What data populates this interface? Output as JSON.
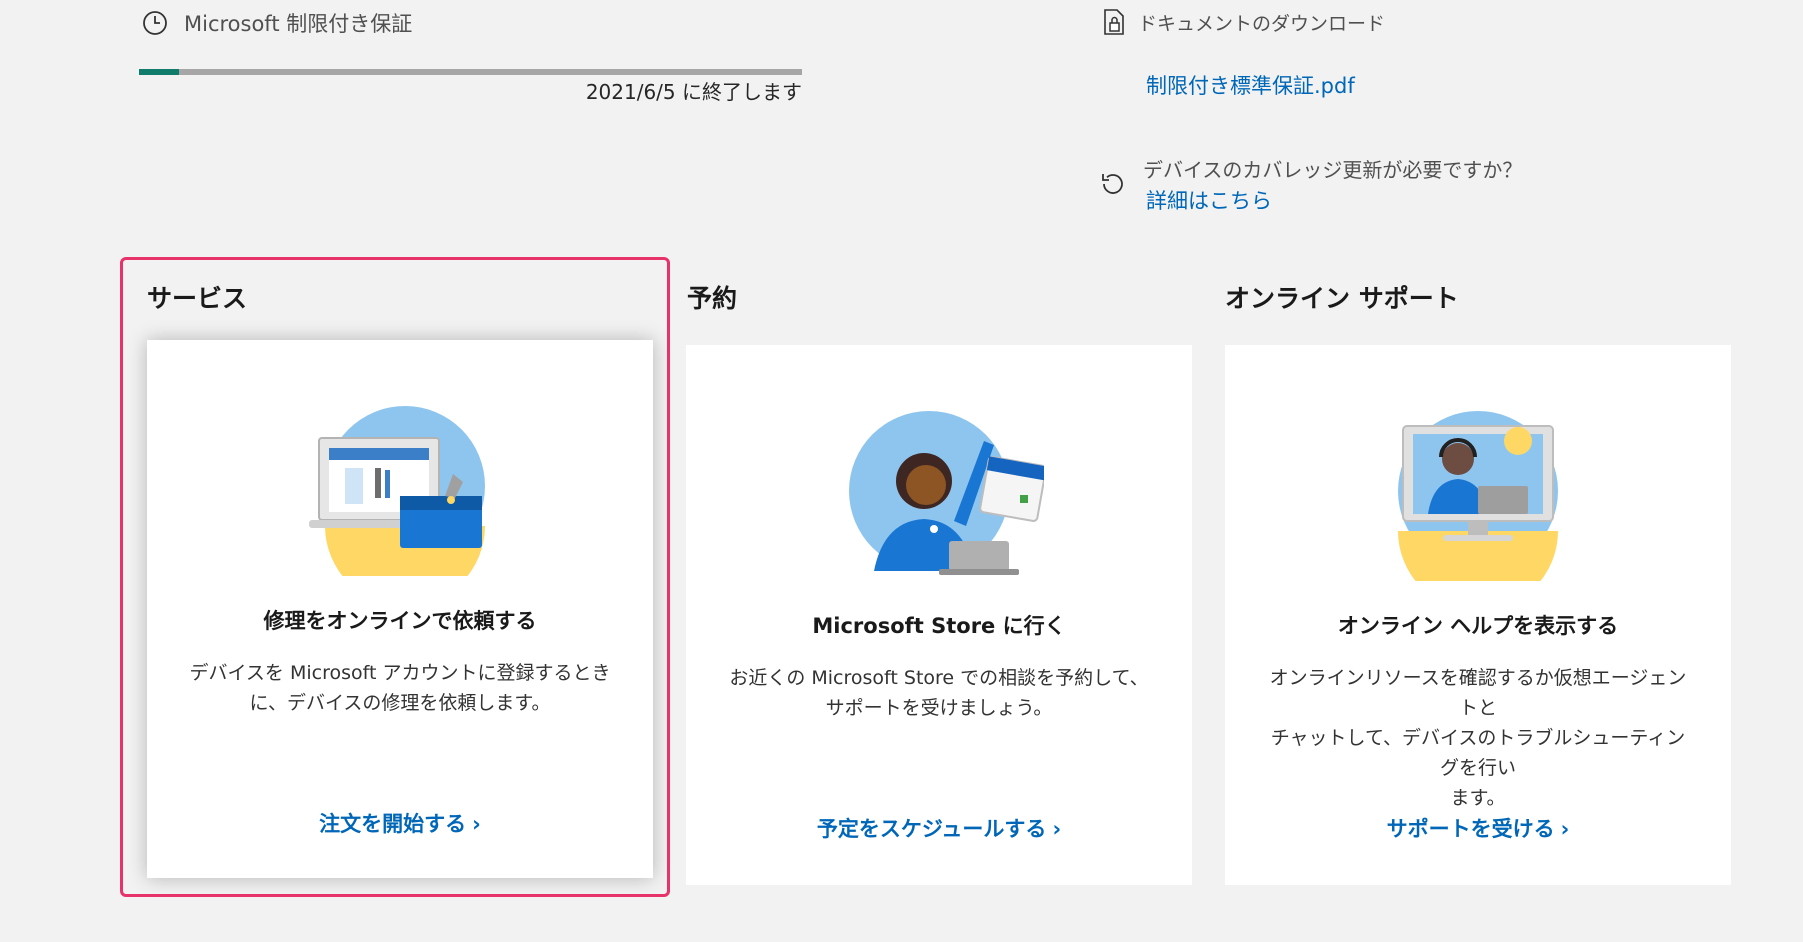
{
  "warranty": {
    "title": "Microsoft 制限付き保証",
    "progress_percent": 6,
    "expiry_text": "2021/6/5 に終了します",
    "colors": {
      "fill": "#107c6b",
      "track": "#a6a6a6"
    },
    "icon": "clock-icon"
  },
  "documents": {
    "heading": "ドキュメントのダウンロード",
    "icon": "document-lock-icon",
    "link_label": "制限付き標準保証.pdf"
  },
  "coverage": {
    "icon": "refresh-icon",
    "question": "デバイスのカバレッジ更新が必要ですか？",
    "link_label": "詳細はこちら"
  },
  "sections": {
    "service": {
      "heading": "サービス",
      "card_title": "修理をオンラインで依頼する",
      "desc_line1": "デバイスを Microsoft アカウントに登録するとき",
      "desc_line2": "に、デバイスの修理を依頼します。",
      "cta": "注文を開始する",
      "illustration": "laptop-toolbox-illustration"
    },
    "booking": {
      "heading": "予約",
      "card_title": "Microsoft Store に行く",
      "desc_line1": "お近くの Microsoft Store での相談を予約して、",
      "desc_line2": "サポートを受けましょう。",
      "cta": "予定をスケジュールする",
      "illustration": "person-calendar-illustration"
    },
    "online": {
      "heading": "オンライン サポート",
      "card_title": "オンライン ヘルプを表示する",
      "desc_line1": "オンラインリソースを確認するか仮想エージェントと",
      "desc_line2": "チャットして、デバイスのトラブルシューティングを行い",
      "desc_line3": "ます。",
      "cta": "サポートを受ける",
      "illustration": "agent-monitor-illustration"
    }
  },
  "chevron": "›",
  "highlight_color": "#e8336a",
  "link_color": "#0067b8"
}
